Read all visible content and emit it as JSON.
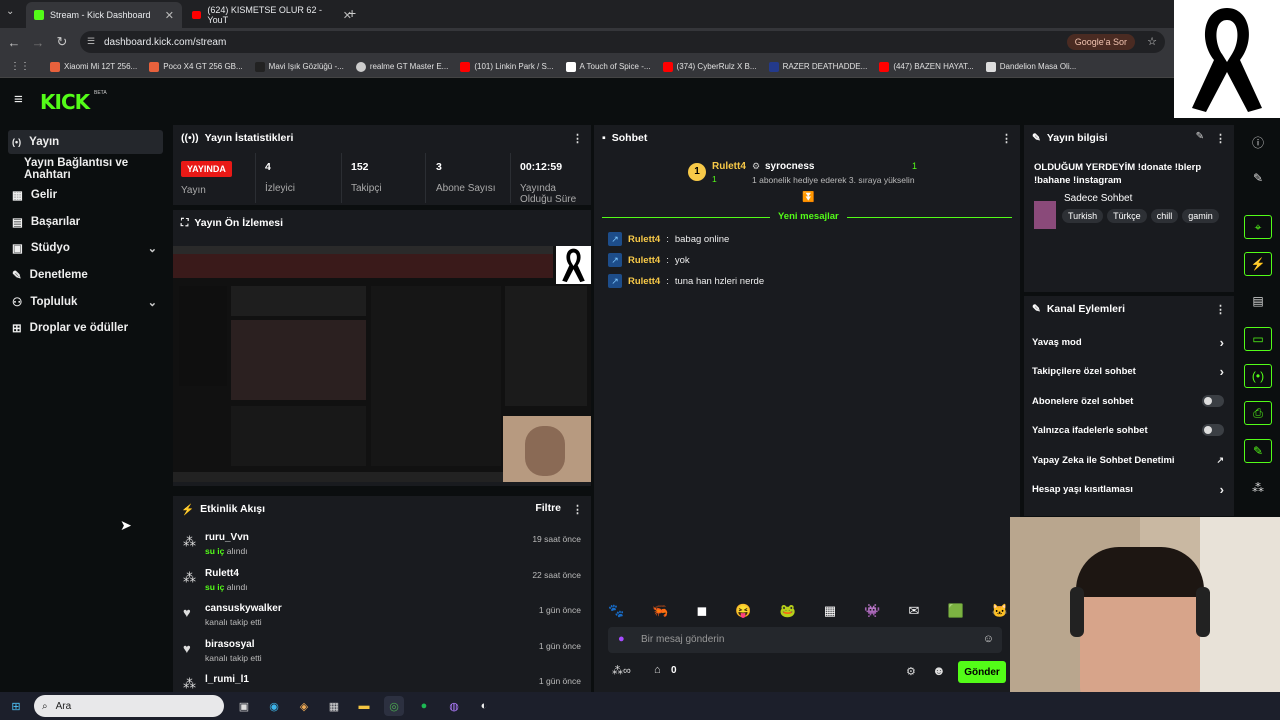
{
  "browser": {
    "tabs": [
      {
        "label": "Stream - Kick Dashboard"
      },
      {
        "label": "(624) KISMETSE OLUR 62 - YouT"
      }
    ],
    "url": "dashboard.kick.com/stream",
    "google_btn": "Google'a Sor",
    "bookmarks": [
      "Xiaomi Mi 12T 256...",
      "Poco X4 GT 256 GB...",
      "Mavi Işık Gözlüğü -...",
      "realme GT Master E...",
      "(101) Linkin Park / S...",
      "A Touch of Spice -...",
      "(374) CyberRulz X B...",
      "RAZER DEATHADDE...",
      "(447) BAZEN HAYAT...",
      "Dandelion Masa Oli..."
    ]
  },
  "brand": {
    "logo": "KICK",
    "beta": "BETA",
    "accent": "#53fc18"
  },
  "sidebar": {
    "items": [
      {
        "label": "Yayın"
      },
      {
        "label": "Yayın Bağlantısı ve Anahtarı"
      },
      {
        "label": "Gelir"
      },
      {
        "label": "Başarılar"
      },
      {
        "label": "Stüdyo"
      },
      {
        "label": "Denetleme"
      },
      {
        "label": "Topluluk"
      },
      {
        "label": "Droplar ve ödüller"
      }
    ]
  },
  "stats": {
    "title": "Yayın İstatistikleri",
    "live_badge": "YAYINDA",
    "live_label": "Yayın",
    "viewers": {
      "value": "4",
      "label": "İzleyici"
    },
    "followers": {
      "value": "152",
      "label": "Takipçi"
    },
    "subs": {
      "value": "3",
      "label": "Abone Sayısı"
    },
    "uptime": {
      "value": "00:12:59",
      "label": "Yayında Olduğu Süre"
    }
  },
  "preview": {
    "title": "Yayın Ön İzlemesi"
  },
  "activity": {
    "title": "Etkinlik Akışı",
    "filter": "Filtre",
    "events": [
      {
        "name": "ruru_Vvn",
        "action_hl": "su iç",
        "action": "alındı",
        "time": "19 saat önce",
        "icon": "gift-icon"
      },
      {
        "name": "Rulett4",
        "action_hl": "su iç",
        "action": "alındı",
        "time": "22 saat önce",
        "icon": "gift-icon"
      },
      {
        "name": "cansuskywalker",
        "action_hl": "",
        "action": "kanalı takip etti",
        "time": "1 gün önce",
        "icon": "heart-icon"
      },
      {
        "name": "birasosyal",
        "action_hl": "",
        "action": "kanalı takip etti",
        "time": "1 gün önce",
        "icon": "heart-icon"
      },
      {
        "name": "l_rumi_l1",
        "action_hl": "",
        "action": "",
        "time": "1 gün önce",
        "icon": "gift-icon"
      }
    ]
  },
  "chat": {
    "title": "Sohbet",
    "pinned": {
      "rank": "1",
      "user": "Rulett4",
      "user_count": "1",
      "gifter": "syrocness",
      "gifter_count": "1",
      "text": "1 abonelik hediye ederek 3. sıraya yükselin"
    },
    "new_messages": "Yeni mesajlar",
    "messages": [
      {
        "user": "Rulett4",
        "text": "babag online"
      },
      {
        "user": "Rulett4",
        "text": "yok"
      },
      {
        "user": "Rulett4",
        "text": "tuna han hzleri nerde"
      }
    ],
    "placeholder": "Bir mesaj gönderin",
    "points": "0",
    "send": "Gönder"
  },
  "stream_info": {
    "title": "Yayın bilgisi",
    "stream_title": "OLDUĞUM YERDEYİM !donate !blerp !bahane !instagram",
    "category": "Sadece Sohbet",
    "tags": [
      "Turkish",
      "Türkçe",
      "chill",
      "gamin"
    ]
  },
  "channel_actions": {
    "title": "Kanal Eylemleri",
    "items": [
      {
        "label": "Yavaş mod",
        "control": "arrow"
      },
      {
        "label": "Takipçilere özel sohbet",
        "control": "arrow"
      },
      {
        "label": "Abonelere özel sohbet",
        "control": "toggle"
      },
      {
        "label": "Yalnızca ifadelerle sohbet",
        "control": "toggle"
      },
      {
        "label": "Yapay Zeka ile Sohbet Denetimi",
        "control": "external"
      },
      {
        "label": "Hesap yaşı kısıtlaması",
        "control": "arrow"
      }
    ]
  },
  "taskbar": {
    "search": "Ara"
  }
}
